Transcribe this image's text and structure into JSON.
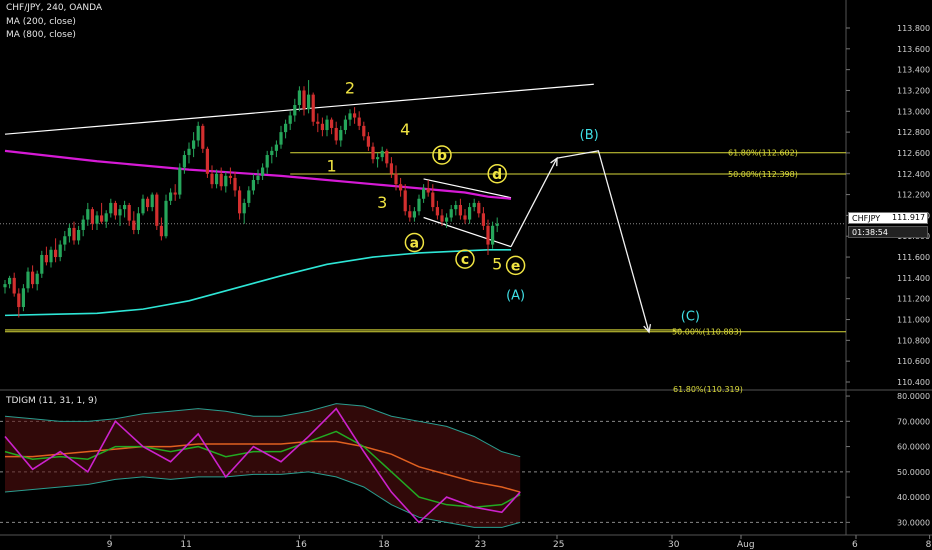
{
  "header": {
    "symbol_line": "CHF/JPY, 240, OANDA",
    "ma200_label": "MA (200, close)",
    "ma800_label": "MA (800, close)",
    "indicator_label": "TDIGM (11, 31, 1, 9)"
  },
  "price_tag": {
    "symbol": "CHFJPY",
    "price": "111.917",
    "countdown": "01:38:54"
  },
  "colors": {
    "background": "#000000",
    "bull": "#26a65b",
    "bear": "#d32f2f",
    "ma200": "#2ee6d6",
    "ma800": "#d61ad6",
    "trendline": "#ffffff",
    "fib": "#d9d93a",
    "wave": "#f0e442",
    "corrective": "#40e0e6",
    "tdi_price": "#cc22cc",
    "tdi_signal": "#22aa22",
    "tdi_middle": "#e06020",
    "tdi_band": "#2a9d8f"
  },
  "chart_data": {
    "type": "candlestick",
    "title": "CHF/JPY, 240, OANDA",
    "price_axis": {
      "ylim": [
        110.3,
        114.0
      ],
      "ticks": [
        "113.800",
        "113.600",
        "113.400",
        "113.200",
        "113.000",
        "112.800",
        "112.600",
        "112.400",
        "112.200",
        "112.000",
        "111.800",
        "111.600",
        "111.400",
        "111.200",
        "111.000",
        "110.800",
        "110.600",
        "110.400"
      ]
    },
    "x_axis": {
      "tick_labels": [
        "9",
        "11",
        "16",
        "18",
        "23",
        "25",
        "30",
        "Aug",
        "6",
        "8"
      ],
      "tick_bars": [
        23,
        39,
        64,
        82,
        103,
        120,
        145,
        160,
        185,
        201
      ]
    },
    "candles_ohlc": [
      [
        111.31,
        111.38,
        111.25,
        111.34
      ],
      [
        111.34,
        111.42,
        111.3,
        111.4
      ],
      [
        111.4,
        111.45,
        111.22,
        111.25
      ],
      [
        111.25,
        111.3,
        111.02,
        111.12
      ],
      [
        111.12,
        111.34,
        111.08,
        111.3
      ],
      [
        111.3,
        111.5,
        111.26,
        111.46
      ],
      [
        111.46,
        111.52,
        111.3,
        111.34
      ],
      [
        111.34,
        111.47,
        111.28,
        111.44
      ],
      [
        111.44,
        111.66,
        111.4,
        111.62
      ],
      [
        111.62,
        111.7,
        111.52,
        111.55
      ],
      [
        111.55,
        111.7,
        111.5,
        111.67
      ],
      [
        111.67,
        111.78,
        111.55,
        111.6
      ],
      [
        111.6,
        111.76,
        111.56,
        111.72
      ],
      [
        111.72,
        111.85,
        111.66,
        111.8
      ],
      [
        111.8,
        111.92,
        111.74,
        111.88
      ],
      [
        111.88,
        111.94,
        111.72,
        111.76
      ],
      [
        111.76,
        111.9,
        111.72,
        111.86
      ],
      [
        111.86,
        112.0,
        111.8,
        111.96
      ],
      [
        111.96,
        112.12,
        111.9,
        112.06
      ],
      [
        112.06,
        112.08,
        111.86,
        111.92
      ],
      [
        111.92,
        112.04,
        111.86,
        112.0
      ],
      [
        112.0,
        112.12,
        111.92,
        111.94
      ],
      [
        111.94,
        112.05,
        111.88,
        112.02
      ],
      [
        112.02,
        112.16,
        111.98,
        112.12
      ],
      [
        112.12,
        112.14,
        111.96,
        112.0
      ],
      [
        112.0,
        112.1,
        111.9,
        112.06
      ],
      [
        112.06,
        112.14,
        111.98,
        112.1
      ],
      [
        112.1,
        112.12,
        111.9,
        111.95
      ],
      [
        111.95,
        112.04,
        111.82,
        111.86
      ],
      [
        111.86,
        112.08,
        111.82,
        112.02
      ],
      [
        112.02,
        112.2,
        112.0,
        112.16
      ],
      [
        112.16,
        112.18,
        112.04,
        112.08
      ],
      [
        112.08,
        112.22,
        112.04,
        112.2
      ],
      [
        112.2,
        112.22,
        111.86,
        111.9
      ],
      [
        111.9,
        111.98,
        111.76,
        111.8
      ],
      [
        111.8,
        112.2,
        111.78,
        112.14
      ],
      [
        112.14,
        112.26,
        112.1,
        112.22
      ],
      [
        112.22,
        112.3,
        112.14,
        112.2
      ],
      [
        112.2,
        112.5,
        112.16,
        112.46
      ],
      [
        112.46,
        112.62,
        112.4,
        112.58
      ],
      [
        112.58,
        112.7,
        112.5,
        112.64
      ],
      [
        112.64,
        112.8,
        112.56,
        112.72
      ],
      [
        112.72,
        112.9,
        112.66,
        112.86
      ],
      [
        112.86,
        112.88,
        112.6,
        112.64
      ],
      [
        112.64,
        112.66,
        112.36,
        112.4
      ],
      [
        112.4,
        112.48,
        112.26,
        112.3
      ],
      [
        112.3,
        112.44,
        112.26,
        112.4
      ],
      [
        112.4,
        112.46,
        112.24,
        112.28
      ],
      [
        112.28,
        112.42,
        112.22,
        112.38
      ],
      [
        112.38,
        112.46,
        112.3,
        112.36
      ],
      [
        112.36,
        112.42,
        112.18,
        112.24
      ],
      [
        112.24,
        112.28,
        111.96,
        112.02
      ],
      [
        112.02,
        112.16,
        111.92,
        112.12
      ],
      [
        112.12,
        112.28,
        112.08,
        112.24
      ],
      [
        112.24,
        112.4,
        112.2,
        112.34
      ],
      [
        112.34,
        112.44,
        112.3,
        112.38
      ],
      [
        112.38,
        112.5,
        112.34,
        112.46
      ],
      [
        112.46,
        112.62,
        112.4,
        112.58
      ],
      [
        112.58,
        112.66,
        112.5,
        112.62
      ],
      [
        112.62,
        112.72,
        112.56,
        112.68
      ],
      [
        112.68,
        112.86,
        112.64,
        112.8
      ],
      [
        112.8,
        112.92,
        112.74,
        112.88
      ],
      [
        112.88,
        113.0,
        112.82,
        112.96
      ],
      [
        112.96,
        113.12,
        112.9,
        113.06
      ],
      [
        113.06,
        113.24,
        113.0,
        113.2
      ],
      [
        113.2,
        113.24,
        112.96,
        113.02
      ],
      [
        113.02,
        113.3,
        112.98,
        113.16
      ],
      [
        113.16,
        113.18,
        112.86,
        112.9
      ],
      [
        112.9,
        112.98,
        112.8,
        112.88
      ],
      [
        112.88,
        112.94,
        112.76,
        112.82
      ],
      [
        112.82,
        112.96,
        112.76,
        112.92
      ],
      [
        112.92,
        112.94,
        112.78,
        112.84
      ],
      [
        112.84,
        112.9,
        112.68,
        112.72
      ],
      [
        112.72,
        112.86,
        112.66,
        112.82
      ],
      [
        112.82,
        112.96,
        112.78,
        112.92
      ],
      [
        112.92,
        113.02,
        112.86,
        112.98
      ],
      [
        112.98,
        113.04,
        112.88,
        112.94
      ],
      [
        112.94,
        113.0,
        112.82,
        112.86
      ],
      [
        112.86,
        112.9,
        112.72,
        112.76
      ],
      [
        112.76,
        112.8,
        112.62,
        112.66
      ],
      [
        112.66,
        112.7,
        112.5,
        112.54
      ],
      [
        112.54,
        112.6,
        112.46,
        112.56
      ],
      [
        112.56,
        112.66,
        112.52,
        112.62
      ],
      [
        112.62,
        112.64,
        112.46,
        112.5
      ],
      [
        112.5,
        112.56,
        112.36,
        112.4
      ],
      [
        112.4,
        112.48,
        112.24,
        112.3
      ],
      [
        112.3,
        112.36,
        112.18,
        112.24
      ],
      [
        112.24,
        112.3,
        112.0,
        112.04
      ],
      [
        112.04,
        112.1,
        111.94,
        111.98
      ],
      [
        111.98,
        112.08,
        111.94,
        112.04
      ],
      [
        112.04,
        112.2,
        112.0,
        112.16
      ],
      [
        112.16,
        112.3,
        112.12,
        112.26
      ],
      [
        112.26,
        112.34,
        112.18,
        112.22
      ],
      [
        112.22,
        112.3,
        112.04,
        112.08
      ],
      [
        112.08,
        112.14,
        111.96,
        112.0
      ],
      [
        112.0,
        112.06,
        111.9,
        111.94
      ],
      [
        111.94,
        112.02,
        111.88,
        111.98
      ],
      [
        111.98,
        112.1,
        111.94,
        112.06
      ],
      [
        112.06,
        112.14,
        112.0,
        112.1
      ],
      [
        112.1,
        112.16,
        111.96,
        112.0
      ],
      [
        112.0,
        112.06,
        111.92,
        111.96
      ],
      [
        111.96,
        112.12,
        111.92,
        112.08
      ],
      [
        112.08,
        112.16,
        112.04,
        112.12
      ],
      [
        112.12,
        112.14,
        111.98,
        112.02
      ],
      [
        112.02,
        112.08,
        111.86,
        111.9
      ],
      [
        111.9,
        111.96,
        111.62,
        111.72
      ],
      [
        111.72,
        111.94,
        111.68,
        111.9
      ],
      [
        111.9,
        111.98,
        111.84,
        111.92
      ]
    ],
    "ma200": {
      "name": "MA (200, close)",
      "x_bars": [
        0,
        10,
        20,
        30,
        40,
        50,
        60,
        70,
        80,
        90,
        100,
        105,
        110
      ],
      "values": [
        111.04,
        111.05,
        111.06,
        111.1,
        111.18,
        111.3,
        111.42,
        111.53,
        111.6,
        111.64,
        111.66,
        111.67,
        111.67
      ]
    },
    "ma800": {
      "name": "MA (800, close)",
      "x_bars": [
        0,
        20,
        40,
        60,
        80,
        100,
        105,
        110
      ],
      "values": [
        112.62,
        112.52,
        112.44,
        112.38,
        112.3,
        112.22,
        112.18,
        112.16
      ]
    },
    "trendlines": [
      {
        "from": [
          0,
          112.78
        ],
        "to": [
          128,
          113.26
        ]
      },
      {
        "from": [
          91,
          112.35
        ],
        "to": [
          110,
          112.17
        ]
      },
      {
        "from": [
          91,
          111.98
        ],
        "to": [
          110,
          111.7
        ]
      },
      {
        "from": [
          0,
          110.9
        ],
        "to": [
          147,
          110.9
        ]
      }
    ],
    "fib_levels": [
      {
        "label": "61.80%(112.602)",
        "price": 112.602,
        "from_bar": 62
      },
      {
        "label": "50.00%(112.398)",
        "price": 112.398,
        "from_bar": 62
      },
      {
        "label": "50.00%(110.883)",
        "price": 110.883,
        "from_bar": 0
      },
      {
        "label": "61.80%(110.319)",
        "price": 110.319,
        "from_bar": 0
      }
    ],
    "projection_path": [
      [
        110,
        111.7
      ],
      [
        120,
        112.55
      ],
      [
        129,
        112.62
      ],
      [
        140,
        110.88
      ]
    ],
    "wave_labels": [
      {
        "text": "2",
        "bar": 75,
        "price": 113.22,
        "style": "plain",
        "color": "wave"
      },
      {
        "text": "4",
        "bar": 87,
        "price": 112.82,
        "style": "plain",
        "color": "wave"
      },
      {
        "text": "1",
        "bar": 71,
        "price": 112.47,
        "style": "plain",
        "color": "wave"
      },
      {
        "text": "3",
        "bar": 82,
        "price": 112.12,
        "style": "plain",
        "color": "wave"
      },
      {
        "text": "5",
        "bar": 107,
        "price": 111.53,
        "style": "plain",
        "color": "wave"
      },
      {
        "text": "b",
        "bar": 95,
        "price": 112.58,
        "style": "circle",
        "color": "wave"
      },
      {
        "text": "d",
        "bar": 107,
        "price": 112.4,
        "style": "circle",
        "color": "wave"
      },
      {
        "text": "a",
        "bar": 89,
        "price": 111.74,
        "style": "circle",
        "color": "wave"
      },
      {
        "text": "c",
        "bar": 100,
        "price": 111.58,
        "style": "circle",
        "color": "wave"
      },
      {
        "text": "e",
        "bar": 111,
        "price": 111.52,
        "style": "circle",
        "color": "wave"
      },
      {
        "text": "(B)",
        "bar": 127,
        "price": 112.78,
        "style": "plain",
        "color": "corrective"
      },
      {
        "text": "(A)",
        "bar": 111,
        "price": 111.24,
        "style": "plain",
        "color": "corrective"
      },
      {
        "text": "(C)",
        "bar": 149,
        "price": 111.04,
        "style": "plain",
        "color": "corrective"
      }
    ],
    "indicator": {
      "name": "TDIGM (11, 31, 1, 9)",
      "ylim": [
        25,
        82
      ],
      "ticks": [
        "80.0000",
        "70.0000",
        "60.0000",
        "50.0000",
        "40.0000",
        "30.0000"
      ],
      "levels": [
        70,
        50,
        30
      ],
      "x_bars": [
        0,
        6,
        12,
        18,
        24,
        30,
        36,
        42,
        48,
        54,
        60,
        66,
        72,
        78,
        84,
        90,
        96,
        102,
        108,
        112
      ],
      "rsi": [
        64,
        51,
        58,
        50,
        70,
        60,
        54,
        65,
        48,
        60,
        54,
        64,
        75,
        58,
        42,
        30,
        40,
        36,
        34,
        42
      ],
      "signal": [
        58,
        55,
        56,
        55,
        60,
        60,
        58,
        60,
        56,
        58,
        58,
        62,
        66,
        60,
        50,
        40,
        37,
        36,
        37,
        41
      ],
      "middle": [
        56,
        56,
        57,
        58,
        59,
        60,
        60,
        61,
        61,
        61,
        61,
        62,
        62,
        60,
        57,
        52,
        49,
        46,
        44,
        42
      ],
      "upper": [
        72,
        71,
        70,
        70,
        71,
        73,
        74,
        75,
        74,
        72,
        72,
        74,
        77,
        76,
        72,
        70,
        68,
        64,
        58,
        56
      ],
      "lower": [
        42,
        43,
        44,
        45,
        47,
        48,
        47,
        48,
        48,
        49,
        49,
        50,
        48,
        44,
        37,
        32,
        30,
        28,
        28,
        30
      ]
    }
  }
}
